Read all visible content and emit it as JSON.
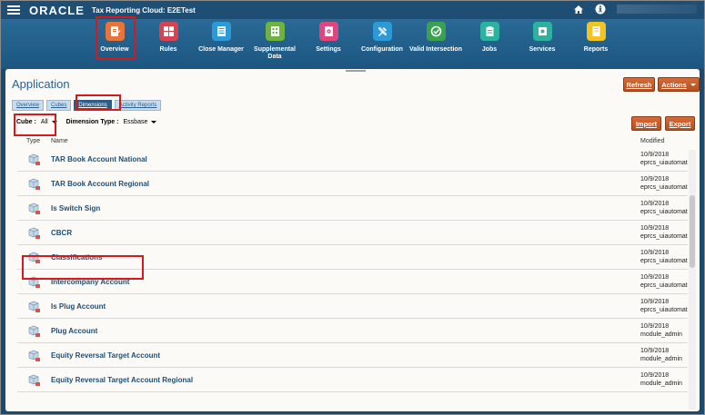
{
  "header": {
    "logo": "ORACLE",
    "app_title": "Tax Reporting Cloud: E2ETest"
  },
  "nav": {
    "items": [
      {
        "label": "Overview",
        "color": "#e8743b"
      },
      {
        "label": "Rules",
        "color": "#d9424f"
      },
      {
        "label": "Close Manager",
        "color": "#2b9ad6"
      },
      {
        "label": "Supplemental Data",
        "color": "#6db33f"
      },
      {
        "label": "Settings",
        "color": "#e0457b"
      },
      {
        "label": "Configuration",
        "color": "#2b9ad6"
      },
      {
        "label": "Valid Intersection",
        "color": "#3aa24f"
      },
      {
        "label": "Jobs",
        "color": "#2bb3a0"
      },
      {
        "label": "Services",
        "color": "#2bb3a0"
      },
      {
        "label": "Reports",
        "color": "#f2c321"
      }
    ]
  },
  "page": {
    "title": "Application",
    "refresh_label": "Refresh",
    "actions_label": "Actions",
    "import_label": "Import",
    "export_label": "Export"
  },
  "tabs": [
    {
      "label": "Overview"
    },
    {
      "label": "Cubes"
    },
    {
      "label": "Dimensions"
    },
    {
      "label": "Activity Reports"
    }
  ],
  "filters": {
    "cube_label": "Cube",
    "cube_value": "All",
    "dimtype_label": "Dimension Type",
    "dimtype_value": "Essbase"
  },
  "table": {
    "columns": {
      "type": "Type",
      "name": "Name",
      "modified": "Modified"
    },
    "rows": [
      {
        "name": "TAR Book Account National",
        "date": "10/9/2018",
        "user": "eprcs_uiautomat"
      },
      {
        "name": "TAR Book Account Regional",
        "date": "10/9/2018",
        "user": "eprcs_uiautomat"
      },
      {
        "name": "Is Switch Sign",
        "date": "10/9/2018",
        "user": "eprcs_uiautomat"
      },
      {
        "name": "CBCR",
        "date": "10/9/2018",
        "user": "eprcs_uiautomat"
      },
      {
        "name": "Classifications",
        "date": "10/9/2018",
        "user": "eprcs_uiautomat"
      },
      {
        "name": "Intercompany Account",
        "date": "10/9/2018",
        "user": "eprcs_uiautomat"
      },
      {
        "name": "Is Plug Account",
        "date": "10/9/2018",
        "user": "eprcs_uiautomat"
      },
      {
        "name": "Plug Account",
        "date": "10/9/2018",
        "user": "module_admin"
      },
      {
        "name": "Equity Reversal Target Account",
        "date": "10/9/2018",
        "user": "module_admin"
      },
      {
        "name": "Equity Reversal Target Account Regional",
        "date": "10/9/2018",
        "user": "module_admin"
      }
    ]
  }
}
